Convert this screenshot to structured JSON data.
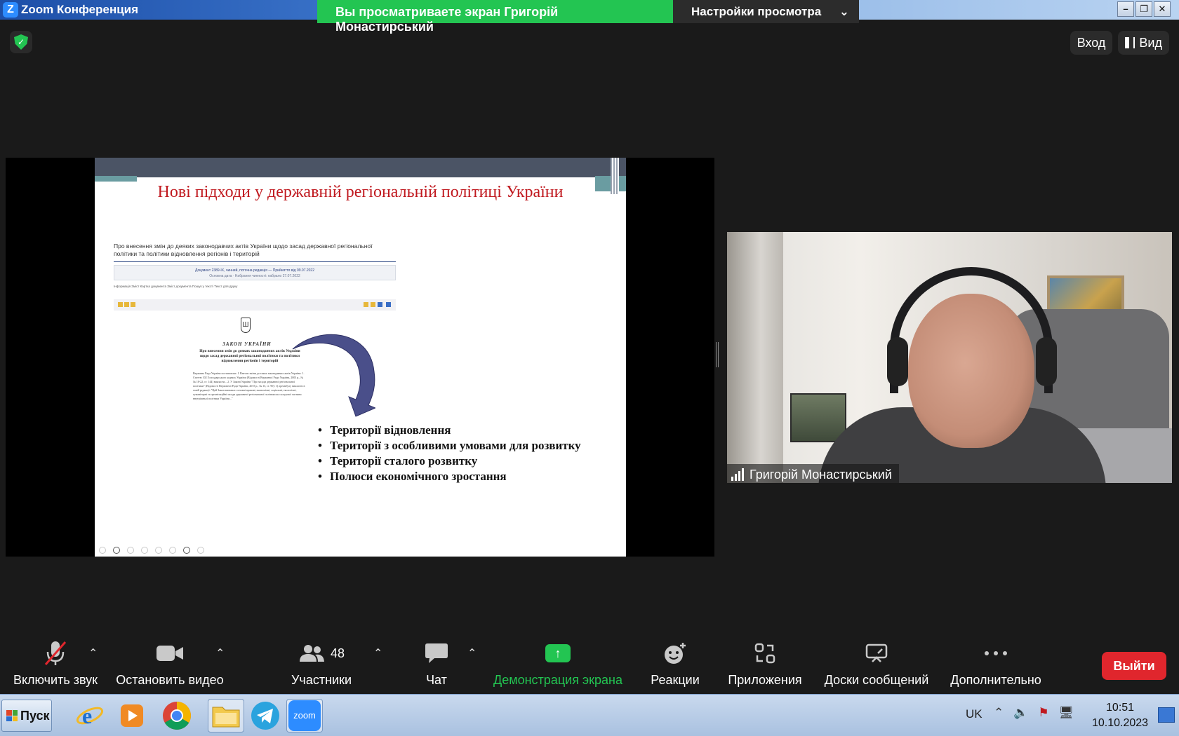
{
  "window": {
    "title": "Zoom Конференция",
    "app_icon": "Z"
  },
  "share_banner": {
    "viewing_text": "Вы просматриваете экран Григорій Монастирський",
    "view_settings_label": "Настройки просмотра"
  },
  "top_controls": {
    "enter_label": "Вход",
    "view_label": "Вид"
  },
  "slide": {
    "title": "Нові підходи у державній регіональній політиці України",
    "doc_heading": "Про внесення змін до деяких законодавчих актів України щодо засад державної регіональної політики та політики відновлення регіонів і територій",
    "doc_box_line1": "Документ 2389-IX, чинний, поточна редакція — Прийняття від 09.07.2022",
    "doc_box_line2": "Основна дата · Набрання чинності: набрало 27.07.2022",
    "doc_tabs": "Інформація   Зміст   Картка документа   Зміст документа   Пошук у тексті   Текст для друку",
    "law_title": "ЗАКОН УКРАЇНИ",
    "law_subtitle": "Про внесення змін до деяких законодавчих актів України щодо засад державної регіональної політики та політики відновлення регіонів і територій",
    "law_body": "Верховна Рада України постановляє: І. Внести зміни до таких законодавчих актів України: 1. Статтю 102 Господарського кодексу України (Відомості Верховної Ради України, 2003 р., №№ 18-22, ст. 144) викласти... 2. У Законі України \"Про засади державної регіональної політики\" (Відомості Верховної Ради України, 2015 р., № 13, ст. 90): 1) преамбулу викласти в такій редакції: \"Цей Закон визначає основні правові, економічні, соціальні, екологічні, гуманітарні та організаційні засади державної регіональної політики як складової частини внутрішньої політики України...\"",
    "bullets": [
      "Території відновлення",
      "Території з особливими умовами для розвитку",
      "Території сталого розвитку",
      "Полюси економічного зростання"
    ]
  },
  "video": {
    "participant_name": "Григорій Монастирський"
  },
  "toolbar": {
    "mute_label": "Включить звук",
    "video_label": "Остановить видео",
    "participants_label": "Участники",
    "participants_count": "48",
    "chat_label": "Чат",
    "share_label": "Демонстрация экрана",
    "reactions_label": "Реакции",
    "apps_label": "Приложения",
    "whiteboards_label": "Доски сообщений",
    "more_label": "Дополнительно",
    "exit_label": "Выйти"
  },
  "taskbar": {
    "start_label": "Пуск",
    "apps": [
      "internet-explorer-icon",
      "media-player-icon",
      "chrome-icon",
      "folder-icon",
      "telegram-icon",
      "zoom-icon"
    ],
    "zoom_label": "zoom",
    "language": "UK",
    "time": "10:51",
    "date": "10.10.2023"
  },
  "colors": {
    "share_green": "#23c552",
    "exit_red": "#e0262d",
    "slide_title_red": "#c0191f",
    "arrow_navy": "#4a4f8a"
  }
}
